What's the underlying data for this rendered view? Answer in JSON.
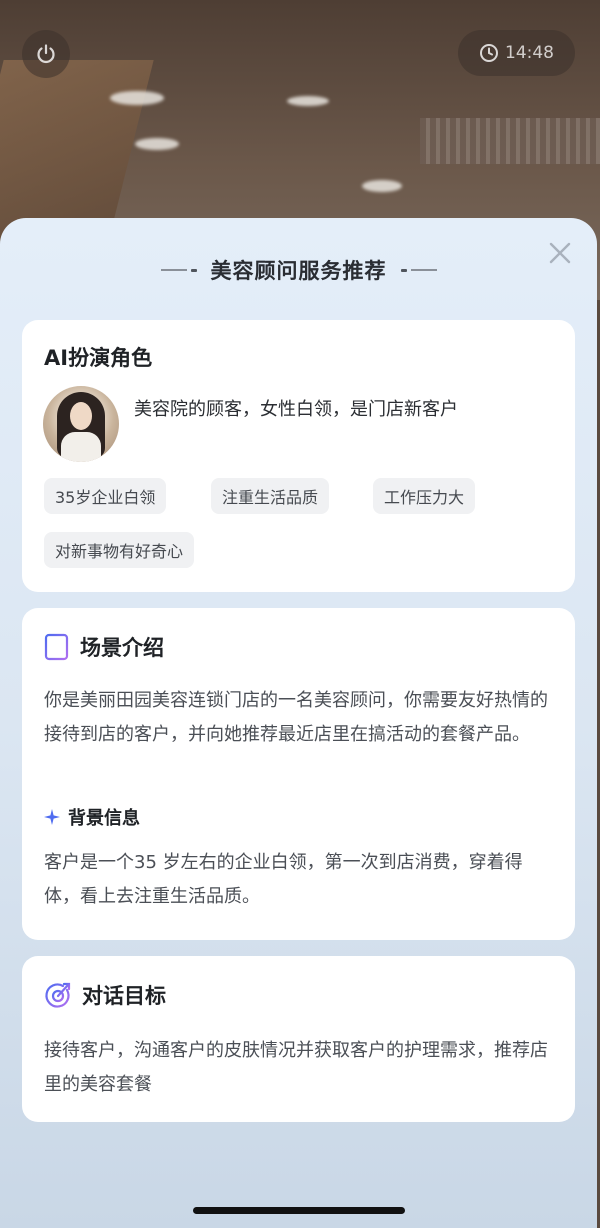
{
  "camera": {
    "timer": "14:48",
    "icons": {
      "power": "power-icon",
      "clock": "clock-icon"
    }
  },
  "sheet": {
    "title": "美容顾问服务推荐",
    "close_icon": "close-icon"
  },
  "role_card": {
    "title": "AI扮演角色",
    "description": "美容院的顾客，女性白领，是门店新客户",
    "tags": [
      "35岁企业白领",
      "注重生活品质",
      "工作压力大",
      "对新事物有好奇心"
    ]
  },
  "scene_card": {
    "title": "场景介绍",
    "icon": "document-icon",
    "text": "你是美丽田园美容连锁门店的一名美容顾问，你需要友好热情的接待到店的客户，并向她推荐最近店里在搞活动的套餐产品。",
    "background": {
      "title": "背景信息",
      "icon": "sparkle-icon",
      "text": "客户是一个35 岁左右的企业白领，第一次到店消费，穿着得体，看上去注重生活品质。"
    }
  },
  "goal_card": {
    "title": "对话目标",
    "icon": "target-icon",
    "text": "接待客户，沟通客户的皮肤情况并获取客户的护理需求，推荐店里的美容套餐"
  },
  "colors": {
    "accent_blue": "#4f6cf0",
    "accent_purple": "#8b5cf6",
    "text_dark": "#1f2226",
    "text_body": "#4b4f56"
  }
}
